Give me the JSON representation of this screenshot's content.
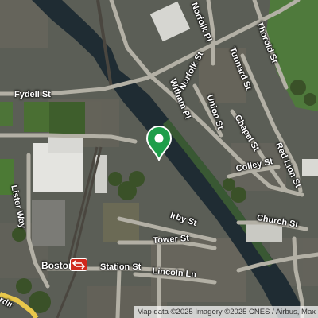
{
  "map": {
    "streets": {
      "fydell_st": "Fydell St",
      "norfolk_pl": "Norfolk Pl",
      "norfolk_st": "Norfolk St",
      "tunnard_st": "Tunnard St",
      "thorold_st": "Thorold St",
      "witham_pl": "Witham Pl",
      "union_st": "Union St",
      "chapel_st": "Chapel St",
      "red_lion_st": "Red Lion St",
      "colley_st": "Colley St",
      "lister_way": "Lister Way",
      "irby_st": "Irby St",
      "church_st": "Church St",
      "tower_st": "Tower St",
      "station_st": "Station St",
      "lincoln_ln": "Lincoln Ln",
      "partial_bottom_left": "rdir"
    },
    "places": {
      "boston": "Boston"
    },
    "icons": {
      "location_pin": "location-pin-icon",
      "rail_station": "rail-station-icon"
    },
    "colors": {
      "pin": "#1e9e4a",
      "station_badge": "#d0281d",
      "river": "#1f2c33",
      "road_yellow": "#e8c74b"
    },
    "attribution": "Map data ©2025 Imagery ©2025 CNES / Airbus, Max"
  }
}
